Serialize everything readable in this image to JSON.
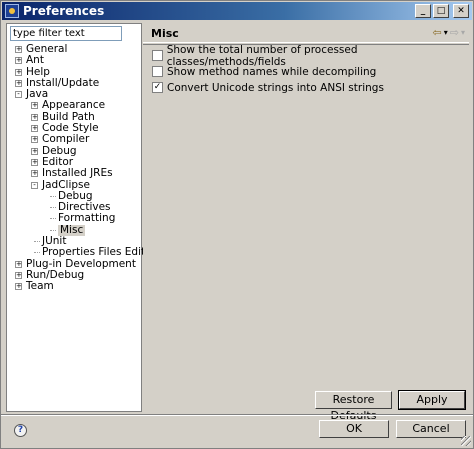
{
  "window": {
    "title": "Preferences",
    "minimize": "_",
    "maximize": "□",
    "close": "✕"
  },
  "filter": {
    "placeholder": "type filter text",
    "value": "type filter text"
  },
  "tree": [
    {
      "label": "General",
      "depth": 0,
      "expander": "+"
    },
    {
      "label": "Ant",
      "depth": 0,
      "expander": "+"
    },
    {
      "label": "Help",
      "depth": 0,
      "expander": "+"
    },
    {
      "label": "Install/Update",
      "depth": 0,
      "expander": "+"
    },
    {
      "label": "Java",
      "depth": 0,
      "expander": "-"
    },
    {
      "label": "Appearance",
      "depth": 1,
      "expander": "+"
    },
    {
      "label": "Build Path",
      "depth": 1,
      "expander": "+"
    },
    {
      "label": "Code Style",
      "depth": 1,
      "expander": "+"
    },
    {
      "label": "Compiler",
      "depth": 1,
      "expander": "+"
    },
    {
      "label": "Debug",
      "depth": 1,
      "expander": "+"
    },
    {
      "label": "Editor",
      "depth": 1,
      "expander": "+"
    },
    {
      "label": "Installed JREs",
      "depth": 1,
      "expander": "+"
    },
    {
      "label": "JadClipse",
      "depth": 1,
      "expander": "-"
    },
    {
      "label": "Debug",
      "depth": 2,
      "expander": ""
    },
    {
      "label": "Directives",
      "depth": 2,
      "expander": ""
    },
    {
      "label": "Formatting",
      "depth": 2,
      "expander": ""
    },
    {
      "label": "Misc",
      "depth": 2,
      "expander": "",
      "selected": true
    },
    {
      "label": "JUnit",
      "depth": 1,
      "expander": ""
    },
    {
      "label": "Properties Files Editor",
      "depth": 1,
      "expander": ""
    },
    {
      "label": "Plug-in Development",
      "depth": 0,
      "expander": "+"
    },
    {
      "label": "Run/Debug",
      "depth": 0,
      "expander": "+"
    },
    {
      "label": "Team",
      "depth": 0,
      "expander": "+"
    }
  ],
  "page": {
    "title": "Misc",
    "nav_back_icon": "back-arrow",
    "nav_forward_icon": "forward-arrow",
    "options": [
      {
        "label": "Show the total number of processed classes/methods/fields",
        "checked": false
      },
      {
        "label": "Show method names while decompiling",
        "checked": false
      },
      {
        "label": "Convert Unicode strings into ANSI strings",
        "checked": true
      }
    ],
    "restore_defaults": "Restore Defaults",
    "apply": "Apply"
  },
  "footer": {
    "help": "?",
    "ok": "OK",
    "cancel": "Cancel"
  },
  "colors": {
    "title_bar_start": "#0a246a",
    "title_bar_end": "#a6caf0",
    "dialog_bg": "#d4d0c8"
  }
}
